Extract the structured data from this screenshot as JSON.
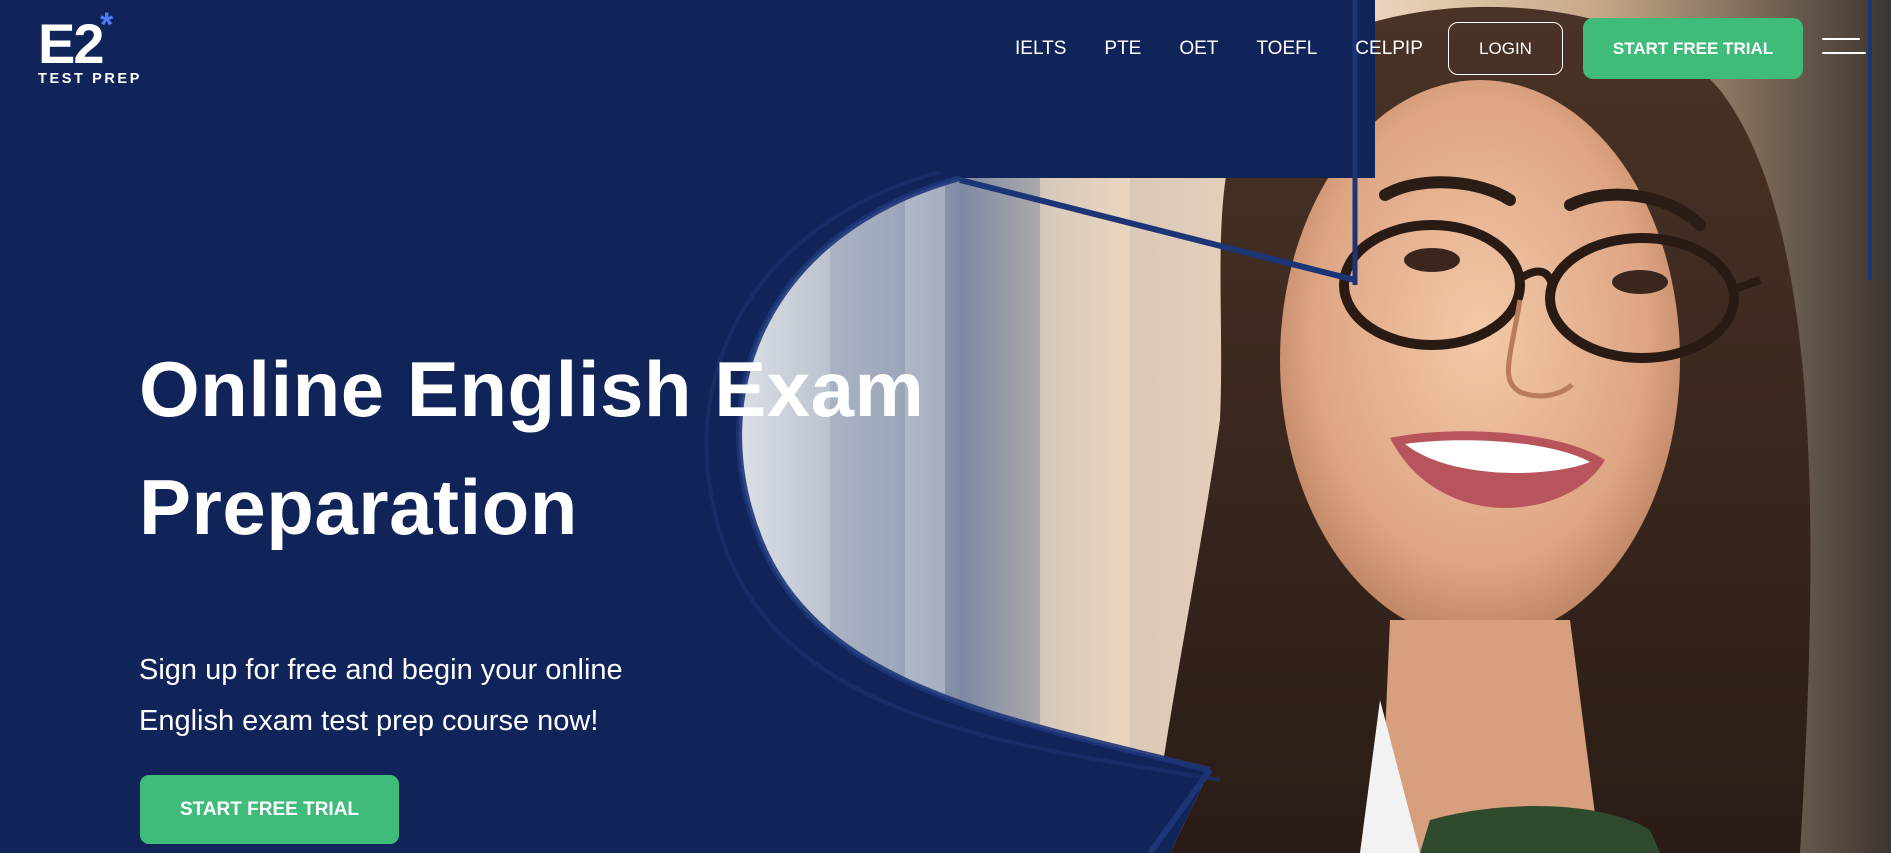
{
  "brand": {
    "logo_mark": "E2",
    "logo_star": "*",
    "logo_subtitle": "TEST PREP"
  },
  "nav": {
    "items": [
      {
        "label": "IELTS"
      },
      {
        "label": "PTE"
      },
      {
        "label": "OET"
      },
      {
        "label": "TOEFL"
      },
      {
        "label": "CELPIP"
      }
    ],
    "login_label": "LOGIN",
    "trial_label": "START FREE TRIAL"
  },
  "hero": {
    "title_line1": "Online English Exam",
    "title_line2": "Preparation",
    "subtitle_line1": "Sign up for free and begin your online",
    "subtitle_line2": "English exam test prep course now!",
    "cta_label": "START FREE TRIAL"
  },
  "colors": {
    "background": "#10245a",
    "accent_green": "#3fbb7a",
    "logo_star_blue": "#4d7cff"
  },
  "icons": {
    "menu": "hamburger-menu-icon"
  }
}
